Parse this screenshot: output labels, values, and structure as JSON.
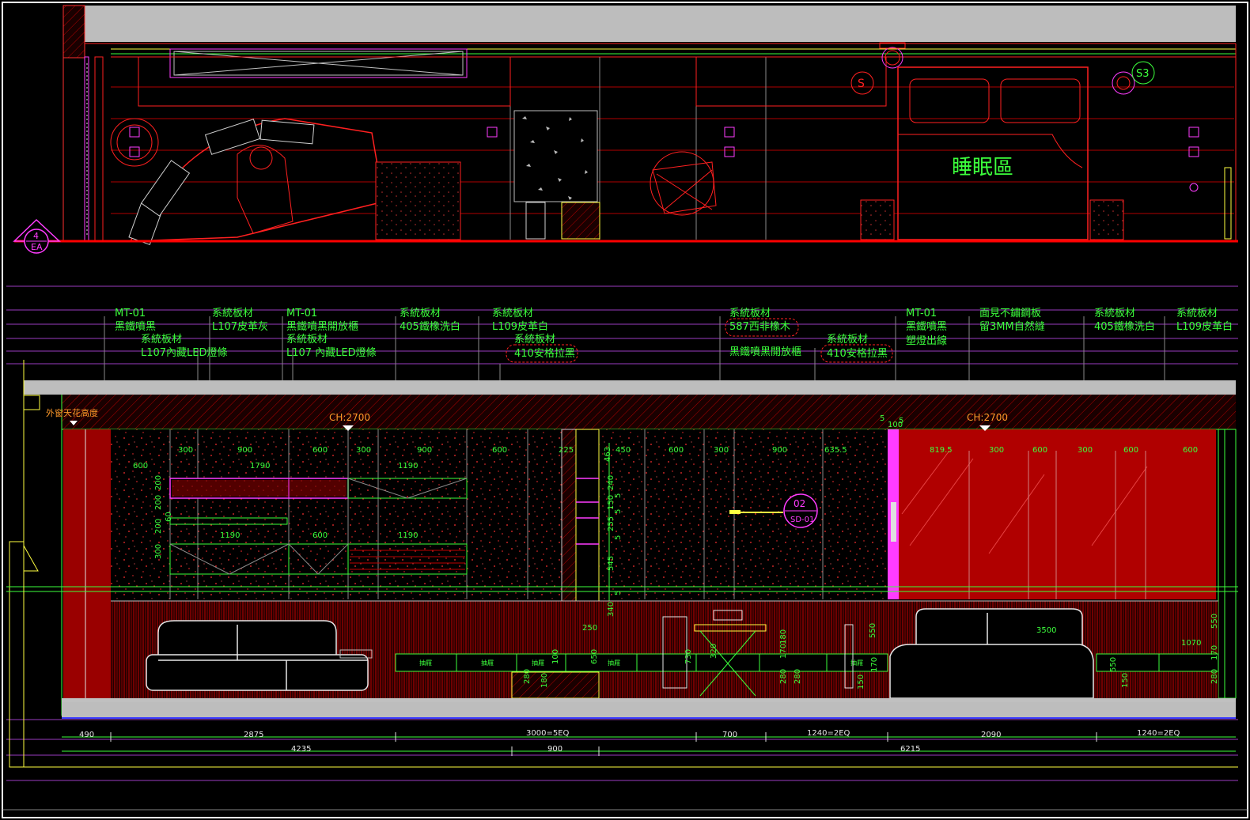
{
  "room_label": "睡眠區",
  "section_tag": {
    "number": "4",
    "sheet": "EA"
  },
  "door_tag": {
    "number": "02",
    "code": "SD-01"
  },
  "ceiling_note": "外窗天花高度",
  "ceiling_heights": [
    "CH:2700",
    "CH:2700"
  ],
  "material_notes": [
    {
      "lines": [
        "MT-01",
        "黑鐵噴黑"
      ]
    },
    {
      "lines": [
        "系統板材",
        "L107內藏LED燈條"
      ]
    },
    {
      "lines": [
        "系統板材",
        "L107皮革灰"
      ]
    },
    {
      "lines": [
        "MT-01",
        "黑鐵噴黑開放櫃",
        "系統板材",
        "L107 內藏LED燈條"
      ]
    },
    {
      "lines": [
        "系統板材",
        "405鐵橡洗白"
      ]
    },
    {
      "lines": [
        "系統板材",
        "L109皮革白",
        "系統板材",
        "410安格拉黑"
      ]
    },
    {
      "lines": [
        "系統板材",
        "587西非橡木",
        "黑鐵噴黑開放櫃"
      ]
    },
    {
      "lines": [
        "系統板材",
        "410安格拉黑"
      ]
    },
    {
      "lines": [
        "MT-01",
        "黑鐵噴黑",
        "塑燈出線"
      ]
    },
    {
      "lines": [
        "面見不鏽鋼板",
        "留3MM自然縫"
      ]
    },
    {
      "lines": [
        "系統板材",
        "405鐵橡洗白"
      ]
    },
    {
      "lines": [
        "系統板材",
        "L109皮革白"
      ]
    }
  ],
  "top_dims": [
    "300",
    "900",
    "600",
    "300",
    "900",
    "600",
    "225",
    "463",
    "450",
    "600",
    "300",
    "900",
    "635.5",
    "819.5",
    "300",
    "600",
    "300",
    "600",
    "600"
  ],
  "cabinet_dims": [
    "600",
    "1790",
    "1190",
    "1190",
    "600",
    "1190"
  ],
  "vertical_dims": [
    "200",
    "200",
    "60",
    "200",
    "300",
    "240",
    "5",
    "150",
    "5",
    "255",
    "5",
    "545",
    "5",
    "340",
    "250"
  ],
  "lower_dims": [
    "3500",
    "1070",
    "550",
    "170",
    "280",
    "150",
    "550",
    "170",
    "280",
    "150",
    "100",
    "650",
    "730",
    "320",
    "180",
    "170",
    "280",
    "550",
    "280",
    "180"
  ],
  "bottom_dims_row1": [
    "490",
    "2875",
    "3000=5EQ",
    "700",
    "1240=2EQ",
    "2090",
    "1240=2EQ"
  ],
  "bottom_dims_row2": [
    "4235",
    "900",
    "6215"
  ],
  "drawer_label": "抽屜",
  "colors": {
    "background": "#000000",
    "text": "#3cff3c",
    "accent_red": "#ff0000",
    "magenta": "#ff3cff",
    "wood": "#8b0000"
  }
}
